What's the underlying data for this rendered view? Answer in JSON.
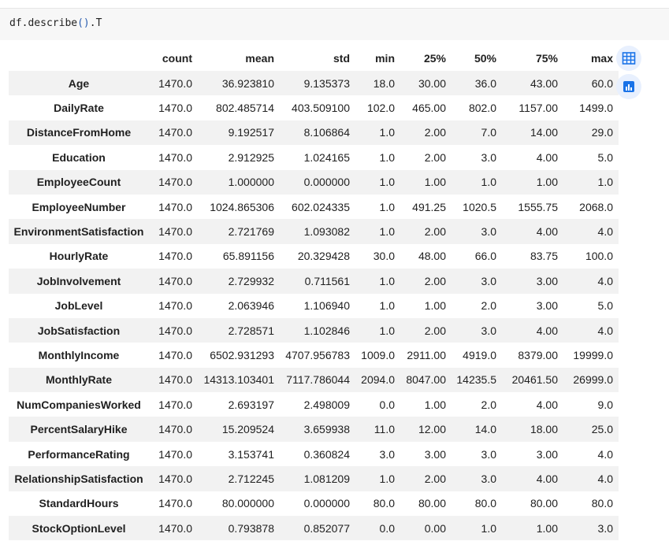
{
  "code_cell": {
    "prefix": "df.describe",
    "paren": "()",
    "suffix": ".T"
  },
  "table": {
    "columns": [
      "count",
      "mean",
      "std",
      "min",
      "25%",
      "50%",
      "75%",
      "max"
    ],
    "rows": [
      {
        "label": "Age",
        "values": [
          "1470.0",
          "36.923810",
          "9.135373",
          "18.0",
          "30.00",
          "36.0",
          "43.00",
          "60.0"
        ]
      },
      {
        "label": "DailyRate",
        "values": [
          "1470.0",
          "802.485714",
          "403.509100",
          "102.0",
          "465.00",
          "802.0",
          "1157.00",
          "1499.0"
        ]
      },
      {
        "label": "DistanceFromHome",
        "values": [
          "1470.0",
          "9.192517",
          "8.106864",
          "1.0",
          "2.00",
          "7.0",
          "14.00",
          "29.0"
        ]
      },
      {
        "label": "Education",
        "values": [
          "1470.0",
          "2.912925",
          "1.024165",
          "1.0",
          "2.00",
          "3.0",
          "4.00",
          "5.0"
        ]
      },
      {
        "label": "EmployeeCount",
        "values": [
          "1470.0",
          "1.000000",
          "0.000000",
          "1.0",
          "1.00",
          "1.0",
          "1.00",
          "1.0"
        ]
      },
      {
        "label": "EmployeeNumber",
        "values": [
          "1470.0",
          "1024.865306",
          "602.024335",
          "1.0",
          "491.25",
          "1020.5",
          "1555.75",
          "2068.0"
        ]
      },
      {
        "label": "EnvironmentSatisfaction",
        "values": [
          "1470.0",
          "2.721769",
          "1.093082",
          "1.0",
          "2.00",
          "3.0",
          "4.00",
          "4.0"
        ]
      },
      {
        "label": "HourlyRate",
        "values": [
          "1470.0",
          "65.891156",
          "20.329428",
          "30.0",
          "48.00",
          "66.0",
          "83.75",
          "100.0"
        ]
      },
      {
        "label": "JobInvolvement",
        "values": [
          "1470.0",
          "2.729932",
          "0.711561",
          "1.0",
          "2.00",
          "3.0",
          "3.00",
          "4.0"
        ]
      },
      {
        "label": "JobLevel",
        "values": [
          "1470.0",
          "2.063946",
          "1.106940",
          "1.0",
          "1.00",
          "2.0",
          "3.00",
          "5.0"
        ]
      },
      {
        "label": "JobSatisfaction",
        "values": [
          "1470.0",
          "2.728571",
          "1.102846",
          "1.0",
          "2.00",
          "3.0",
          "4.00",
          "4.0"
        ]
      },
      {
        "label": "MonthlyIncome",
        "values": [
          "1470.0",
          "6502.931293",
          "4707.956783",
          "1009.0",
          "2911.00",
          "4919.0",
          "8379.00",
          "19999.0"
        ]
      },
      {
        "label": "MonthlyRate",
        "values": [
          "1470.0",
          "14313.103401",
          "7117.786044",
          "2094.0",
          "8047.00",
          "14235.5",
          "20461.50",
          "26999.0"
        ]
      },
      {
        "label": "NumCompaniesWorked",
        "values": [
          "1470.0",
          "2.693197",
          "2.498009",
          "0.0",
          "1.00",
          "2.0",
          "4.00",
          "9.0"
        ]
      },
      {
        "label": "PercentSalaryHike",
        "values": [
          "1470.0",
          "15.209524",
          "3.659938",
          "11.0",
          "12.00",
          "14.0",
          "18.00",
          "25.0"
        ]
      },
      {
        "label": "PerformanceRating",
        "values": [
          "1470.0",
          "3.153741",
          "0.360824",
          "3.0",
          "3.00",
          "3.0",
          "3.00",
          "4.0"
        ]
      },
      {
        "label": "RelationshipSatisfaction",
        "values": [
          "1470.0",
          "2.712245",
          "1.081209",
          "1.0",
          "2.00",
          "3.0",
          "4.00",
          "4.0"
        ]
      },
      {
        "label": "StandardHours",
        "values": [
          "1470.0",
          "80.000000",
          "0.000000",
          "80.0",
          "80.00",
          "80.0",
          "80.00",
          "80.0"
        ]
      },
      {
        "label": "StockOptionLevel",
        "values": [
          "1470.0",
          "0.793878",
          "0.852077",
          "0.0",
          "0.00",
          "1.0",
          "1.00",
          "3.0"
        ]
      }
    ]
  },
  "side_buttons": {
    "table_icon": "table-grid-icon",
    "chart_icon": "bar-chart-icon",
    "accent_color": "#1a73e8",
    "button_bg": "#e8f0fe"
  },
  "colors": {
    "code_bg": "#f7f7f7",
    "row_stripe": "#f2f2f2"
  }
}
